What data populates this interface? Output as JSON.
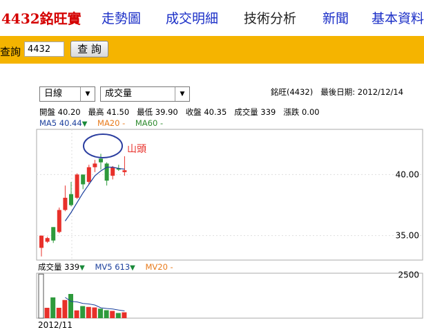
{
  "nav": {
    "stock": "4432銘旺實",
    "items": [
      "走勢圖",
      "成交明細",
      "技術分析",
      "新聞",
      "基本資料"
    ],
    "active": "技術分析"
  },
  "query": {
    "label": "查詢",
    "value": "4432",
    "button": "查 詢"
  },
  "controls": {
    "period": "日線",
    "indicator": "成交量"
  },
  "info": {
    "stock": "銘旺(4432)",
    "last_date_label": "最後日期:",
    "last_date": "2012/12/14"
  },
  "ohlc": {
    "open_label": "開盤",
    "open": "40.20",
    "high_label": "最高",
    "high": "41.50",
    "low_label": "最低",
    "low": "39.90",
    "close_label": "收盤",
    "close": "40.35",
    "volume_label": "成交量",
    "volume": "339",
    "change_label": "漲跌",
    "change": "0.00"
  },
  "ma": {
    "ma5": "MA5 40.44",
    "ma20": "MA20 -",
    "ma60": "MA60 -"
  },
  "vol_legend": {
    "vol": "成交量 339",
    "mv5": "MV5 613",
    "mv20": "MV20 -"
  },
  "annotation": "山頭",
  "colors": {
    "up": "#e8302a",
    "down": "#2e9a3c",
    "ma_line": "#1b3f9c",
    "gold": "#f5b400",
    "circle": "#2b3ea0"
  },
  "chart_data": [
    {
      "type": "candlestick",
      "ylim": [
        33,
        43.7
      ],
      "ticks": [
        "40.00",
        "35.00"
      ],
      "tick_values": [
        40,
        35
      ],
      "candles": [
        {
          "o": 34,
          "h": 35,
          "l": 33.3,
          "c": 35,
          "dir": "up"
        },
        {
          "o": 34.5,
          "h": 34.9,
          "l": 34.4,
          "c": 34.8,
          "dir": "up"
        },
        {
          "o": 34.6,
          "h": 35.7,
          "l": 34.4,
          "c": 35.7,
          "dir": "down"
        },
        {
          "o": 35.3,
          "h": 37.3,
          "l": 35.2,
          "c": 37.1,
          "dir": "up"
        },
        {
          "o": 37.1,
          "h": 39.1,
          "l": 37.0,
          "c": 38.1,
          "dir": "up"
        },
        {
          "o": 37.5,
          "h": 39.4,
          "l": 37.4,
          "c": 38.4,
          "dir": "down"
        },
        {
          "o": 38.1,
          "h": 40.1,
          "l": 38.0,
          "c": 40.0,
          "dir": "up"
        },
        {
          "o": 40.0,
          "h": 40.0,
          "l": 38.8,
          "c": 39.2,
          "dir": "down"
        },
        {
          "o": 39.4,
          "h": 40.8,
          "l": 39.2,
          "c": 40.6,
          "dir": "up"
        },
        {
          "o": 40.6,
          "h": 41.2,
          "l": 40.2,
          "c": 40.9,
          "dir": "up"
        },
        {
          "o": 41.0,
          "h": 41.7,
          "l": 40.4,
          "c": 41.3,
          "dir": "down"
        },
        {
          "o": 40.9,
          "h": 41.0,
          "l": 39.1,
          "c": 39.5,
          "dir": "down"
        },
        {
          "o": 40.6,
          "h": 40.7,
          "l": 39.6,
          "c": 39.9,
          "dir": "up"
        },
        {
          "o": 40.4,
          "h": 40.8,
          "l": 40.3,
          "c": 40.5,
          "dir": "down"
        },
        {
          "o": 40.2,
          "h": 41.5,
          "l": 39.9,
          "c": 40.35,
          "dir": "up"
        }
      ],
      "ma5": [
        null,
        null,
        null,
        null,
        36.2,
        36.9,
        37.7,
        38.5,
        39.2,
        39.9,
        40.3,
        40.6,
        40.6,
        40.5,
        40.44
      ]
    },
    {
      "type": "bar",
      "ylim": [
        0,
        2600
      ],
      "ticks": [
        "2500"
      ],
      "tick_values": [
        2500
      ],
      "x_label": "2012/11",
      "values": [
        2550,
        600,
        1200,
        600,
        1050,
        1400,
        450,
        700,
        650,
        620,
        550,
        460,
        420,
        300,
        339
      ],
      "dirs": [
        "up",
        "up",
        "down",
        "up",
        "up",
        "down",
        "up",
        "down",
        "up",
        "up",
        "down",
        "down",
        "up",
        "down",
        "up"
      ],
      "mv5": [
        null,
        null,
        null,
        null,
        1200,
        970,
        940,
        850,
        820,
        760,
        600,
        560,
        530,
        470,
        420
      ]
    }
  ]
}
